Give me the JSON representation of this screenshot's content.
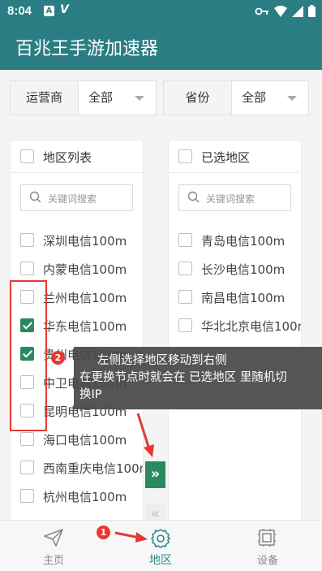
{
  "status_bar": {
    "time": "8:04",
    "notif_letter": "A"
  },
  "app_title": "百兆王手游加速器",
  "filters": {
    "carrier": {
      "label": "运营商",
      "value": "全部"
    },
    "province": {
      "label": "省份",
      "value": "全部"
    }
  },
  "left_panel": {
    "title": "地区列表",
    "search_placeholder": "关键词搜索",
    "items": [
      {
        "label": "深圳电信100m",
        "checked": false
      },
      {
        "label": "内蒙电信100m",
        "checked": false
      },
      {
        "label": "兰州电信100m",
        "checked": false
      },
      {
        "label": "华东电信100m",
        "checked": true
      },
      {
        "label": "贵州电信100m",
        "checked": true
      },
      {
        "label": "中卫电信100m",
        "checked": false
      },
      {
        "label": "昆明电信100m",
        "checked": false
      },
      {
        "label": "海口电信100m",
        "checked": false
      },
      {
        "label": "西南重庆电信100m",
        "checked": false
      },
      {
        "label": "杭州电信100m",
        "checked": false
      }
    ]
  },
  "right_panel": {
    "title": "已选地区",
    "search_placeholder": "关键词搜索",
    "items": [
      {
        "label": "青岛电信100m"
      },
      {
        "label": "长沙电信100m"
      },
      {
        "label": "南昌电信100m"
      },
      {
        "label": "华北北京电信100m"
      }
    ]
  },
  "transfer": {
    "move_right": "»",
    "move_left": "«"
  },
  "tooltip": {
    "badge": "2",
    "line1": "左侧选择地区移动到右侧",
    "line2": "在更换节点时就会在 已选地区 里随机切",
    "line3": "换IP"
  },
  "nav_badge": "1",
  "bottom_nav": [
    {
      "label": "主页",
      "icon": "paper-plane-icon"
    },
    {
      "label": "地区",
      "icon": "gear-icon",
      "active": true
    },
    {
      "label": "设备",
      "icon": "device-icon"
    }
  ],
  "colors": {
    "primary": "#2a7d83",
    "check": "#2a8a5f",
    "annotation": "#e53935"
  }
}
